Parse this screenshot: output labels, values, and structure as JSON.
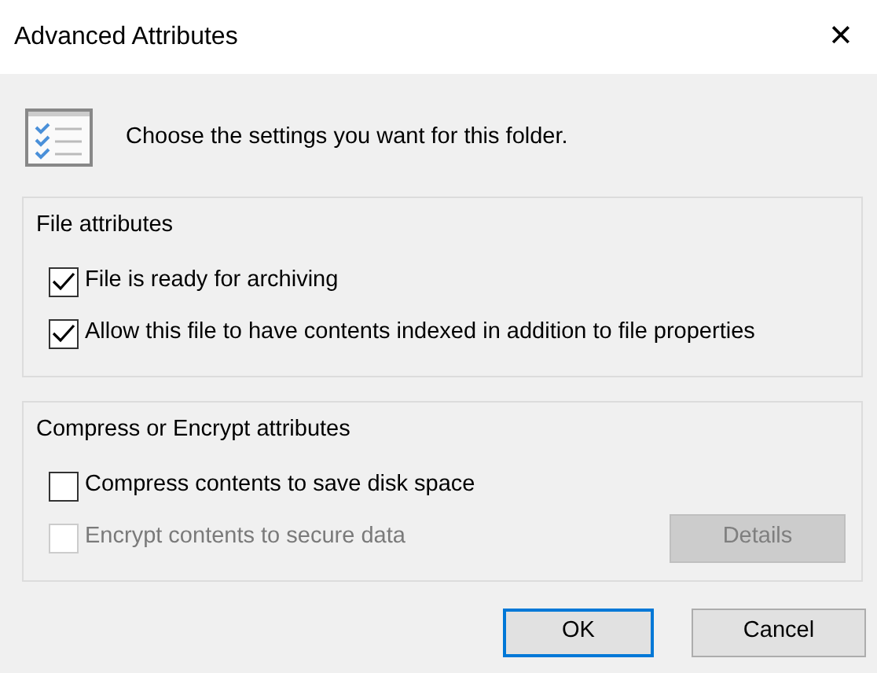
{
  "window": {
    "title": "Advanced Attributes",
    "close": "✕"
  },
  "intro": "Choose the settings you want for this folder.",
  "groups": [
    {
      "title": "File attributes",
      "options": [
        {
          "label": "File is ready for archiving",
          "checked": true,
          "disabled": false
        },
        {
          "label": "Allow this file to have contents indexed in addition to file properties",
          "checked": true,
          "disabled": false
        }
      ]
    },
    {
      "title": "Compress or Encrypt attributes",
      "options": [
        {
          "label": "Compress contents to save disk space",
          "checked": false,
          "disabled": false
        },
        {
          "label": "Encrypt contents to secure data",
          "checked": false,
          "disabled": true,
          "button": {
            "label": "Details",
            "disabled": true
          }
        }
      ]
    }
  ],
  "buttons": [
    {
      "label": "OK",
      "default": true
    },
    {
      "label": "Cancel",
      "default": false
    }
  ]
}
